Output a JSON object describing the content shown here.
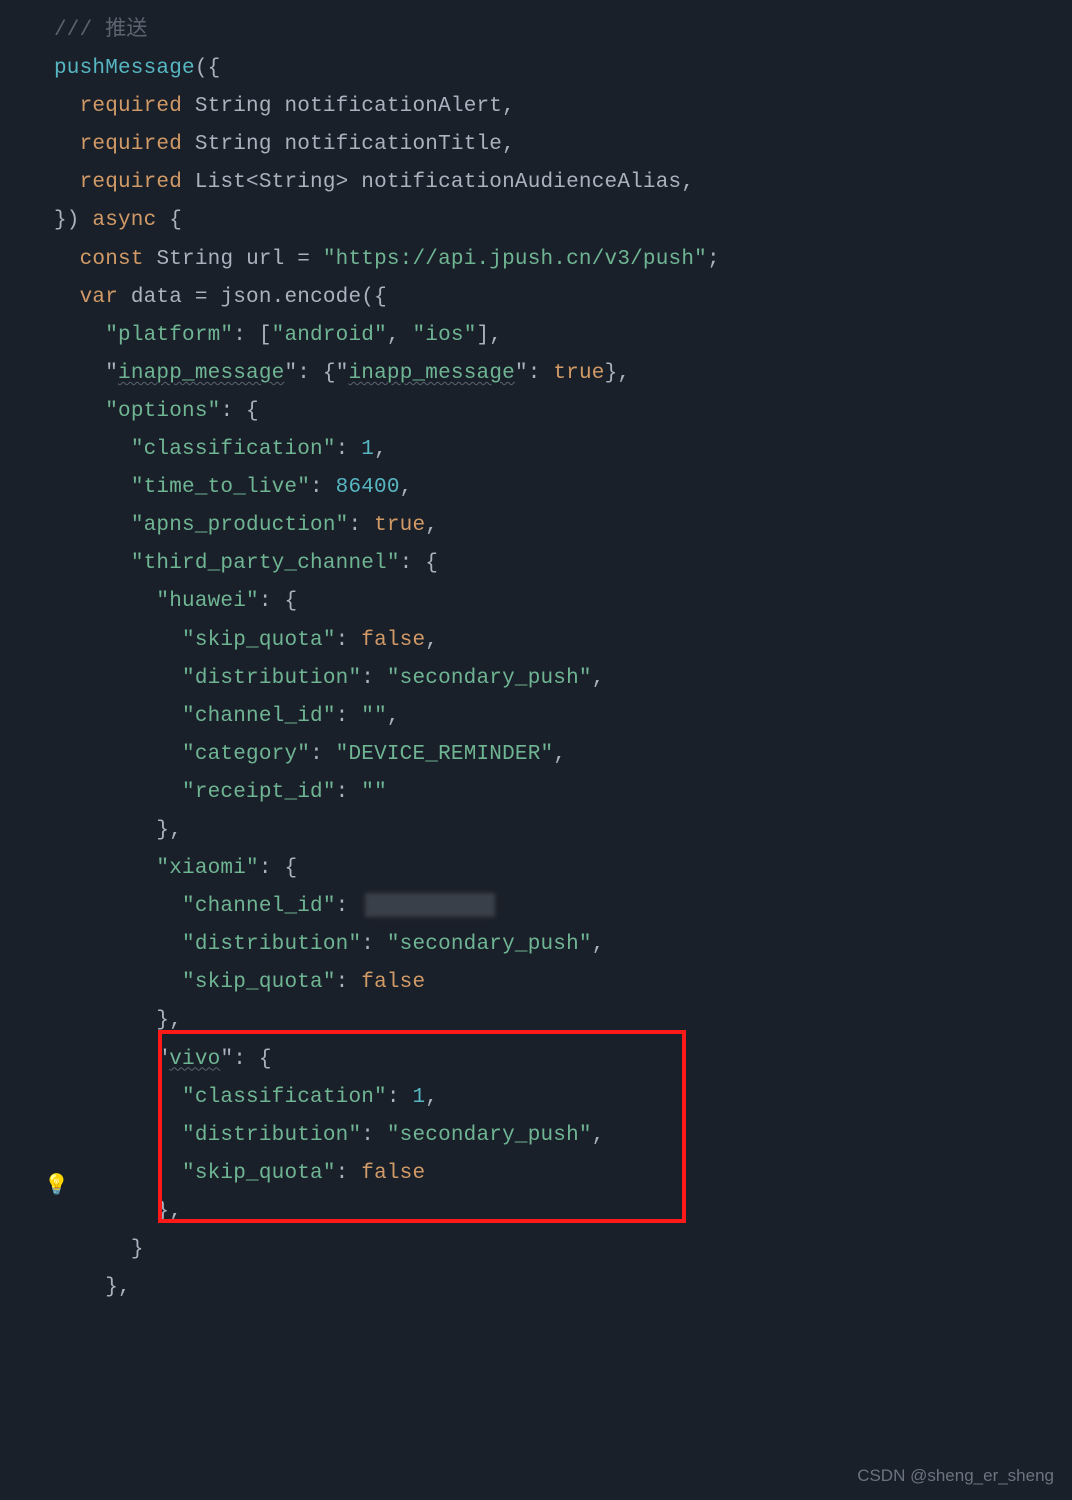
{
  "code": {
    "comment": "/// 推送",
    "fn_name": "pushMessage",
    "open": "({",
    "p1_kw": "required",
    "p1_type": "String",
    "p1_name": "notificationAlert",
    "p2_kw": "required",
    "p2_type": "String",
    "p2_name": "notificationTitle",
    "p3_kw": "required",
    "p3_type": "List<String>",
    "p3_name": "notificationAudienceAlias",
    "close_paren": "}) ",
    "async": "async",
    "brace": " {",
    "const_kw": "const",
    "const_type": "String",
    "const_name": "url",
    "eq": " = ",
    "url_str": "\"https://api.jpush.cn/v3/push\"",
    "semi": ";",
    "var_kw": "var",
    "var_name": "data",
    "json_call": "json.encode({",
    "k_platform": "\"platform\"",
    "v_android": "\"android\"",
    "v_ios": "\"ios\"",
    "k_inapp": "\"inapp_message\"",
    "v_true": "true",
    "k_options": "\"options\"",
    "k_classification": "\"classification\"",
    "v_one": "1",
    "k_ttl": "\"time_to_live\"",
    "v_86400": "86400",
    "k_apns": "\"apns_production\"",
    "k_tpc": "\"third_party_channel\"",
    "k_huawei": "\"huawei\"",
    "k_skip": "\"skip_quota\"",
    "v_false": "false",
    "k_dist": "\"distribution\"",
    "v_secondary": "\"secondary_push\"",
    "k_chanid": "\"channel_id\"",
    "v_empty": "\"\"",
    "k_category": "\"category\"",
    "v_device": "\"DEVICE_REMINDER\"",
    "k_receipt": "\"receipt_id\"",
    "k_xiaomi": "\"xiaomi\"",
    "k_vivo": "\"vivo\""
  },
  "watermark": "CSDN @sheng_er_sheng",
  "bulb": "💡"
}
